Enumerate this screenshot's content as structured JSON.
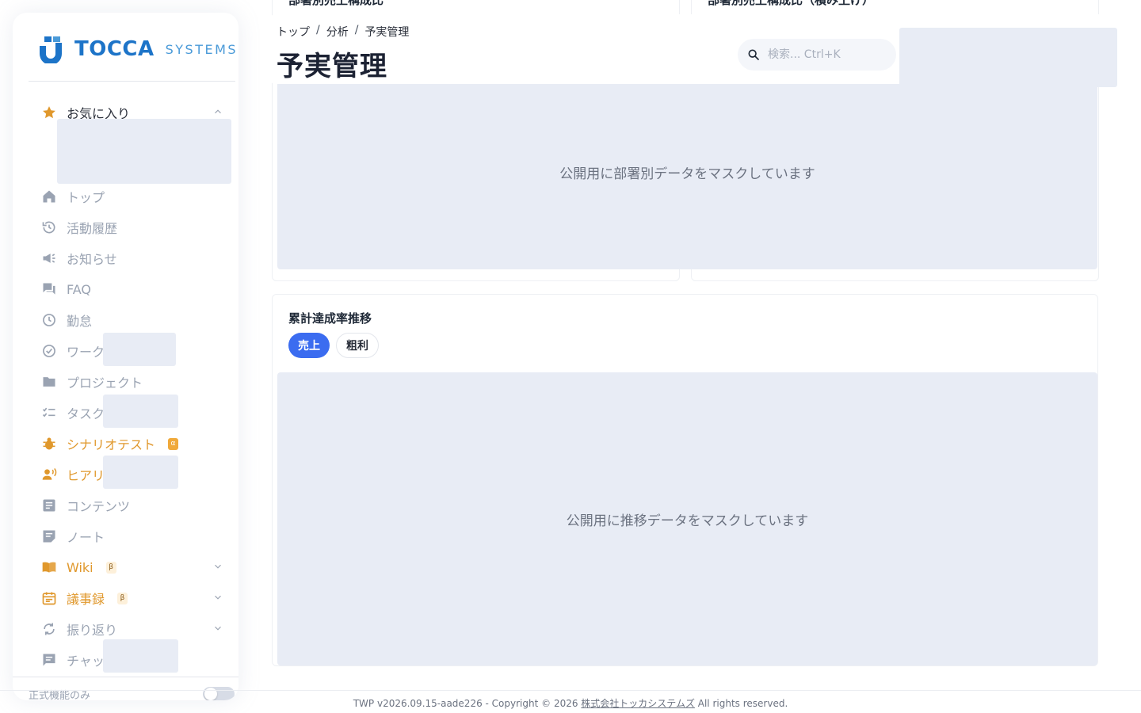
{
  "brand": {
    "name": "TOCCA",
    "suffix": "SYSTEMS"
  },
  "header": {
    "breadcrumb": [
      "トップ",
      "分析",
      "予実管理"
    ],
    "breadcrumb_separator": "/",
    "title": "予実管理",
    "search_placeholder": "検索... Ctrl+K"
  },
  "sidebar": {
    "favorites": {
      "label": "お気に入り",
      "icon": "star-icon"
    },
    "items": [
      {
        "label": "トップ",
        "icon": "home-icon"
      },
      {
        "label": "活動履歴",
        "icon": "history-icon"
      },
      {
        "label": "お知らせ",
        "icon": "megaphone-icon"
      },
      {
        "label": "FAQ",
        "icon": "forum-icon"
      },
      {
        "label": "勤怠",
        "icon": "clock-icon"
      },
      {
        "label": "ワーク",
        "icon": "check-circle-icon"
      },
      {
        "label": "プロジェクト",
        "icon": "folder-icon"
      },
      {
        "label": "タスク",
        "icon": "checklist-icon"
      },
      {
        "label": "シナリオテスト",
        "icon": "bug-icon",
        "badge": "α"
      },
      {
        "label": "ヒアリ",
        "icon": "voice-icon"
      },
      {
        "label": "コンテンツ",
        "icon": "article-icon"
      },
      {
        "label": "ノート",
        "icon": "note-icon"
      },
      {
        "label": "Wiki",
        "icon": "book-icon",
        "badge": "β"
      },
      {
        "label": "議事録",
        "icon": "calendar-icon",
        "badge": "β"
      },
      {
        "label": "振り返り",
        "icon": "refresh-icon"
      },
      {
        "label": "チャッ",
        "icon": "chat-icon"
      }
    ],
    "footer_label": "正式機能のみ",
    "footer_toggle_on": false
  },
  "cards": {
    "dept_ratio_title": "部署別売上構成比",
    "dept_ratio_stacked_title": "部署別売上構成比（積み上げ）",
    "dept_mask_text": "公開用に部署別データをマスクしています",
    "trend_title": "累計達成率推移",
    "trend_chips": [
      "売上",
      "粗利"
    ],
    "trend_active_chip": "売上",
    "trend_mask_text": "公開用に推移データをマスクしています"
  },
  "footer": {
    "prefix": "TWP v2026.09.15-aade226 - Copyright © 2026 ",
    "company": "株式会社トッカシステムズ",
    "suffix": " All rights reserved."
  },
  "colors": {
    "primary": "#3b6cf0",
    "brand_blue": "#1d74c8",
    "accent_orange": "#e0982c",
    "mask_bg": "#e8ecf5",
    "muted_text": "#9aa3b2"
  }
}
